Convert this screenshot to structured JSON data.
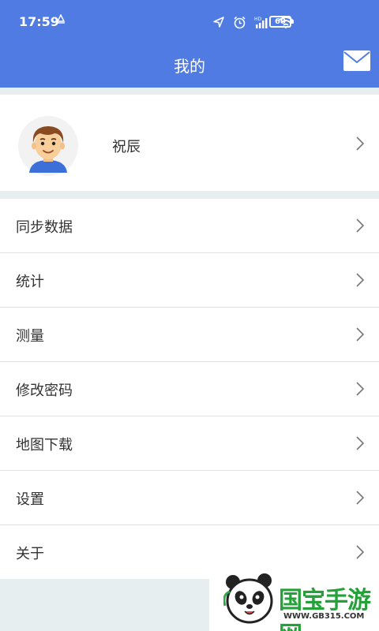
{
  "status_bar": {
    "time": "17:59",
    "alert_icon": "triangle-alert-icon",
    "battery": "60"
  },
  "header": {
    "title": "我的",
    "mail_icon": "mail-icon"
  },
  "profile": {
    "name": "祝辰"
  },
  "menu": {
    "items": [
      {
        "label": "同步数据"
      },
      {
        "label": "统计"
      },
      {
        "label": "测量"
      },
      {
        "label": "修改密码"
      },
      {
        "label": "地图下载"
      },
      {
        "label": "设置"
      },
      {
        "label": "关于"
      }
    ]
  },
  "watermark": {
    "title": "国宝手游网",
    "url": "WWW.GB315.COM"
  },
  "colors": {
    "primary": "#4f7be3",
    "background": "#e7eef0",
    "watermark": "#25a13a"
  }
}
